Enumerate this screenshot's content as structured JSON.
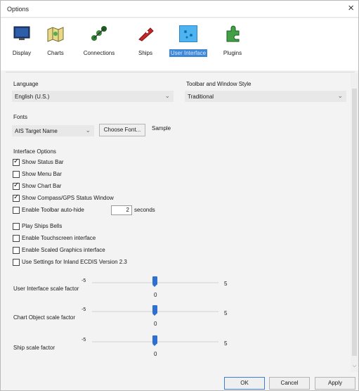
{
  "window": {
    "title": "Options",
    "close_glyph": "×"
  },
  "toolbar": {
    "items": [
      {
        "label": "Display",
        "icon": "display-icon",
        "active": false
      },
      {
        "label": "Charts",
        "icon": "charts-icon",
        "active": false
      },
      {
        "label": "Connections",
        "icon": "connections-icon",
        "active": false
      },
      {
        "label": "Ships",
        "icon": "ships-icon",
        "active": false
      },
      {
        "label": "User Interface",
        "icon": "user-interface-icon",
        "active": true
      },
      {
        "label": "Plugins",
        "icon": "plugins-icon",
        "active": false
      }
    ]
  },
  "language": {
    "heading": "Language",
    "value": "English (U.S.)"
  },
  "toolbar_style": {
    "heading": "Toolbar and Window Style",
    "value": "Traditional"
  },
  "fonts": {
    "heading": "Fonts",
    "selected": "AIS Target Name",
    "choose_button": "Choose Font...",
    "sample_label": "Sample"
  },
  "interface_options": {
    "heading": "Interface Options",
    "checkboxes": [
      {
        "label": "Show Status Bar",
        "checked": true
      },
      {
        "label": "Show Menu Bar",
        "checked": false
      },
      {
        "label": "Show Chart Bar",
        "checked": true
      },
      {
        "label": "Show Compass/GPS Status Window",
        "checked": true
      },
      {
        "label": "Enable Toolbar auto-hide",
        "checked": false
      },
      {
        "label": "Play Ships Bells",
        "checked": false
      },
      {
        "label": "Enable Touchscreen interface",
        "checked": false
      },
      {
        "label": "Enable Scaled Graphics interface",
        "checked": false
      },
      {
        "label": "Use Settings for Inland ECDIS Version 2.3",
        "checked": false
      }
    ],
    "autohide_value": "2",
    "autohide_unit": "seconds"
  },
  "sliders": [
    {
      "label": "User Interface scale factor",
      "min": "-5",
      "max": "5",
      "value": "0"
    },
    {
      "label": "Chart Object scale factor",
      "min": "-5",
      "max": "5",
      "value": "0"
    },
    {
      "label": "Ship scale factor",
      "min": "-5",
      "max": "5",
      "value": "0"
    }
  ],
  "buttons": {
    "ok": "OK",
    "cancel": "Cancel",
    "apply": "Apply"
  },
  "colors": {
    "accent": "#3d86d8",
    "slider_thumb": "#2f6fd1"
  }
}
